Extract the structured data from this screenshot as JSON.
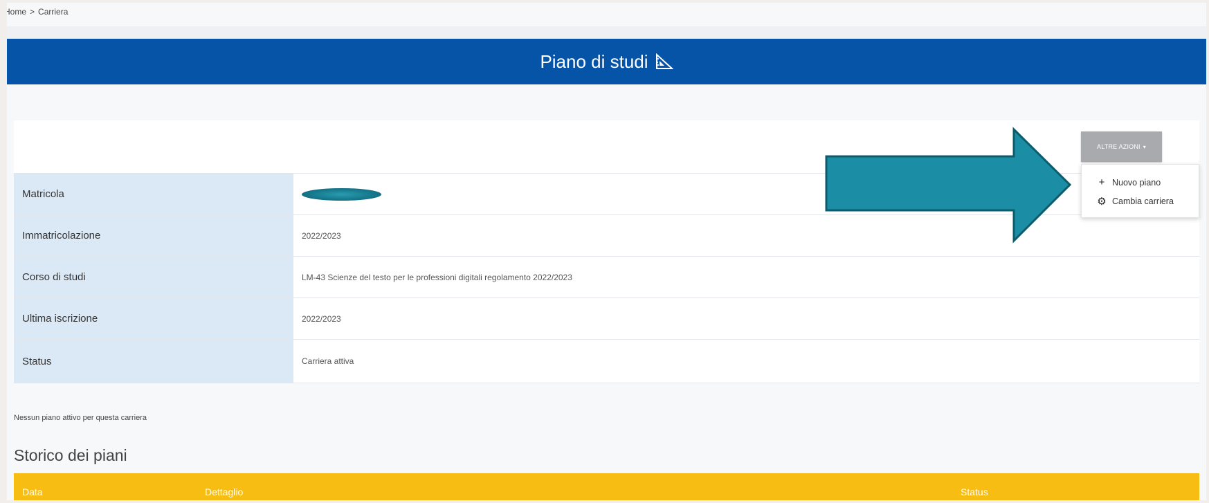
{
  "breadcrumb": {
    "home": "Home",
    "separator": ">",
    "current": "Carriera"
  },
  "header": {
    "title": "Piano di studi",
    "icon": "triangle-ruler-icon",
    "color": "#0654a8"
  },
  "actions": {
    "button_label": "ALTRE AZIONI",
    "caret": "▾",
    "menu": [
      {
        "icon": "plus-icon",
        "glyph": "+",
        "label": "Nuovo piano"
      },
      {
        "icon": "gear-icon",
        "glyph": "⚙",
        "label": "Cambia carriera"
      }
    ]
  },
  "info": {
    "rows": [
      {
        "label": "Matricola",
        "value": ""
      },
      {
        "label": "Immatricolazione",
        "value": "2022/2023"
      },
      {
        "label": "Corso di studi",
        "value": "LM-43 Scienze del testo per le professioni digitali  regolamento 2022/2023"
      },
      {
        "label": "Ultima iscrizione",
        "value": "2022/2023"
      },
      {
        "label": "Status",
        "value": "Carriera attiva"
      }
    ]
  },
  "no_active_plan": "Nessun piano attivo per questa carriera",
  "history": {
    "title": "Storico dei piani",
    "columns": [
      "Data",
      "Dettaglio",
      "Status"
    ],
    "header_color": "#f7bd13"
  },
  "annotation": {
    "arrow_color": "#1b8ea6"
  }
}
